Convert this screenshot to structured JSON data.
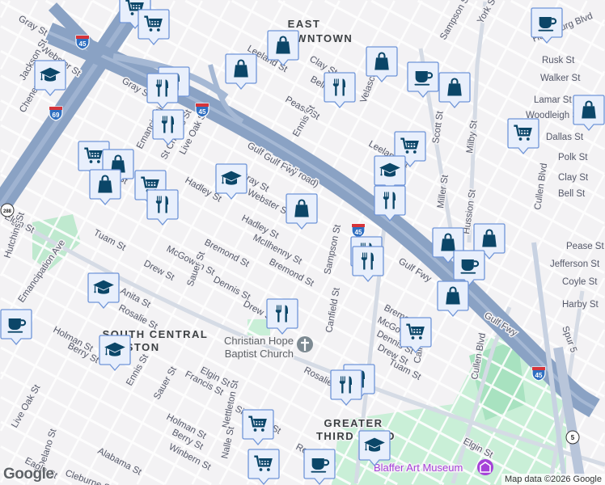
{
  "map": {
    "districts": [
      [
        "EAST",
        "DOWNTOWN"
      ],
      [
        "SOUTH CENTRAL",
        "HOUSTON"
      ],
      [
        "GREATER",
        "THIRD WARD"
      ]
    ],
    "poi": {
      "church": [
        "Christian Hope",
        "Baptist Church"
      ],
      "museum": "Blaffer Art Museum"
    },
    "streets": [
      "Gray St",
      "Webster St",
      "Gray St",
      "Jackson St",
      "Chenevert St",
      "McGowen St",
      "Emancipation Ave",
      "St Charles St",
      "Live Oak St",
      "Hadley St",
      "Webster St",
      "Gray St",
      "Gulf Fwy (Toll road)",
      "Leeland St",
      "Clay St",
      "Bell St",
      "Pease St",
      "Ennis St",
      "Velasco St",
      "Sampson St",
      "York St",
      "Harrisburg Blvd",
      "Rusk St",
      "Walker St",
      "Lamar St",
      "Woodleigh St",
      "Dallas St",
      "Polk St",
      "Clay St",
      "Bell St",
      "Milby St",
      "Scott St",
      "Miller St",
      "Hussion St",
      "Cullen Blvd",
      "Leeland St",
      "Hadley St",
      "McIlhenny St",
      "Bremond St",
      "Bremond St",
      "Sampson St",
      "McGowen St",
      "Tuam St",
      "Drew St",
      "Dennis St",
      "Sauer St",
      "Anita St",
      "Rosalie St",
      "Drew St",
      "Elgin St",
      "Hutchins St",
      "Emancipation Ave",
      "Holman St",
      "Berry St",
      "Ennis St",
      "Sauer St",
      "Francis St",
      "Live Oak St",
      "Delano St",
      "Elgin St",
      "Holman St",
      "Berry St",
      "Winbern St",
      "Nettleton St",
      "Nalle St",
      "Simmons St",
      "Alabama St",
      "Eagle St",
      "Cleburne St",
      "Reeves St",
      "Canfield St",
      "Bremond St",
      "McGowen St",
      "Dennis St",
      "Drew St",
      "Tuam St",
      "Rosalie St",
      "Callie St",
      "Cullen Blvd",
      "Elgin St",
      "Gulf Fwy",
      "Gulf Fwy",
      "Spur 5",
      "Pease St",
      "Jefferson St",
      "Coyle St",
      "Harby St",
      "Gulf Fwy"
    ],
    "shields": [
      "45",
      "45",
      "45",
      "45",
      "69",
      "5",
      "288"
    ],
    "markers": [
      "cart",
      "cart",
      "bag",
      "bag",
      "graduation-cap",
      "food",
      "food",
      "food",
      "bag",
      "cup",
      "bag",
      "cup",
      "cart",
      "food",
      "cart",
      "bag",
      "bag",
      "cart",
      "food",
      "graduation-cap",
      "bag",
      "cart",
      "graduation-cap",
      "food",
      "food",
      "food",
      "bag",
      "bag",
      "cup",
      "bag",
      "cup",
      "graduation-cap",
      "graduation-cap",
      "food",
      "cart",
      "food",
      "food",
      "cart",
      "graduation-cap",
      "cup",
      "cart",
      "bag"
    ],
    "colors": {
      "marker_fill": "#e8effc",
      "marker_stroke": "#6f95d8",
      "icon": "#0b4668",
      "freeway": "#8aa2c4",
      "park": "#bfe9cf"
    },
    "attribution": "Map data ©2026 Google",
    "logo": "Google"
  }
}
